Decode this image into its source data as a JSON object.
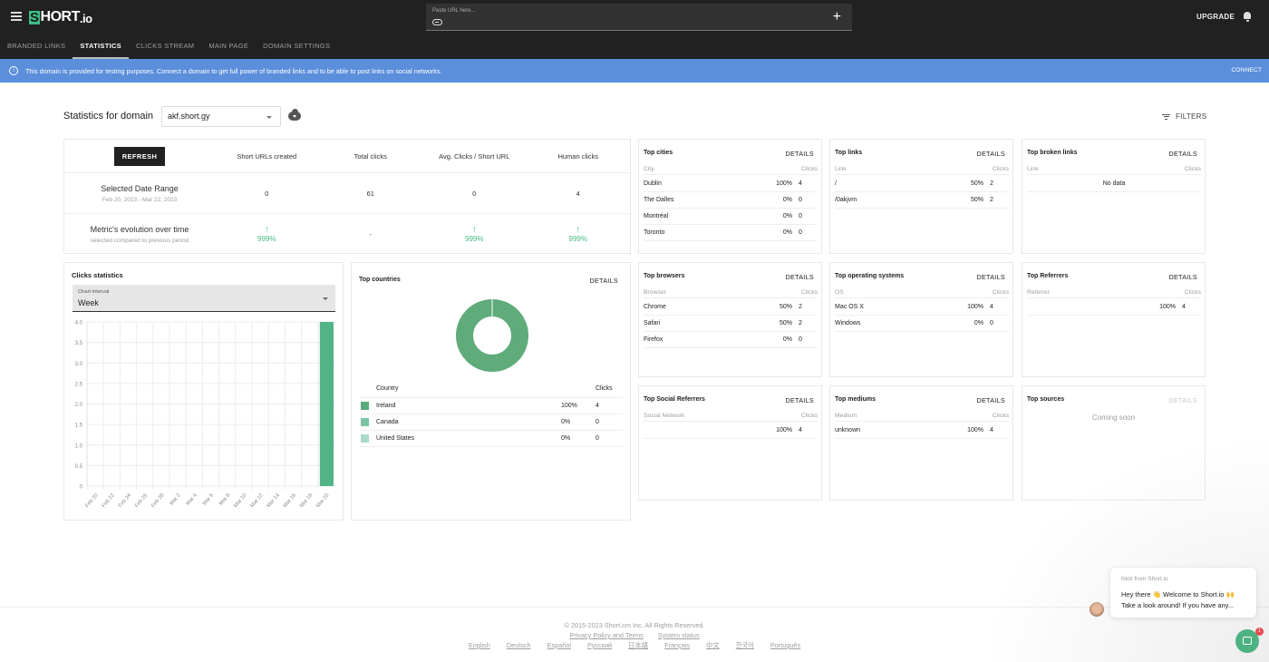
{
  "app": {
    "logo_s": "S",
    "logo_text": "HORT",
    "logo_suffix": ".io",
    "url_placeholder": "Paste URL here...",
    "upgrade_label": "UPGRADE",
    "nav_tabs": [
      {
        "label": "BRANDED LINKS",
        "active": false
      },
      {
        "label": "STATISTICS",
        "active": true
      },
      {
        "label": "CLICKS STREAM",
        "active": false
      },
      {
        "label": "MAIN PAGE",
        "active": false
      },
      {
        "label": "DOMAIN SETTINGS",
        "active": false
      }
    ]
  },
  "banner": {
    "text": "This domain is provided for testing purposes. Connect a domain to get full power of branded links and to be able to post links on social networks.",
    "action": "CONNECT",
    "info_icon": "i"
  },
  "header": {
    "title": "Statistics for domain",
    "domain": "akf.short.gy",
    "filters_label": "FILTERS"
  },
  "summary": {
    "refresh_label": "REFRESH",
    "columns": [
      "Short URLs created",
      "Total clicks",
      "Avg. Clicks / Short URL",
      "Human clicks"
    ],
    "range_label": "Selected Date Range",
    "range_dates": "Feb 20, 2023 - Mar 22, 2023",
    "values": [
      "0",
      "61",
      "0",
      "4"
    ],
    "evolution_label": "Metric's evolution over time",
    "evolution_sub": "selected compared to previous period",
    "evolution": [
      {
        "arrow": "↑",
        "pct": "999%"
      },
      {
        "arrow": "",
        "pct": "-"
      },
      {
        "arrow": "↑",
        "pct": "999%"
      },
      {
        "arrow": "↑",
        "pct": "999%"
      }
    ]
  },
  "clicks_stats": {
    "title": "Clicks statistics",
    "interval_label": "Chart interval",
    "interval_value": "Week"
  },
  "chart_data": {
    "type": "bar",
    "title": "Clicks statistics",
    "xlabel": "",
    "ylabel": "",
    "categories": [
      "Feb 20",
      "Feb 22",
      "Feb 24",
      "Feb 26",
      "Feb 28",
      "Mar 2",
      "Mar 4",
      "Mar 6",
      "Mar 8",
      "Mar 10",
      "Mar 12",
      "Mar 14",
      "Mar 16",
      "Mar 18",
      "Mar 20"
    ],
    "values": [
      0,
      0,
      0,
      0,
      0,
      0,
      0,
      0,
      0,
      0,
      0,
      0,
      0,
      0,
      4
    ],
    "ylim": [
      0,
      4
    ],
    "yticks": [
      "0",
      "0.5",
      "1.0",
      "1.5",
      "2.0",
      "2.5",
      "3.0",
      "3.5",
      "4.0"
    ],
    "grid": true,
    "bar_color": "#52b386"
  },
  "countries": {
    "title": "Top countries",
    "details": "DETAILS",
    "col_country": "Country",
    "col_clicks": "Clicks",
    "rows": [
      {
        "name": "Ireland",
        "pct": "100%",
        "clicks": "4",
        "color": "#5aac7c"
      },
      {
        "name": "Canada",
        "pct": "0%",
        "clicks": "0",
        "color": "#7cc4a4"
      },
      {
        "name": "United States",
        "pct": "0%",
        "clicks": "0",
        "color": "#a9d9cb"
      }
    ],
    "donut": [
      {
        "label": "Ireland",
        "value": 100,
        "color": "#5fab7a"
      }
    ]
  },
  "cards": {
    "cities": {
      "title": "Top cities",
      "details": "DETAILS",
      "col1": "City",
      "col2": "Clicks",
      "rows": [
        {
          "name": "Dublin",
          "pct": "100%",
          "clicks": "4"
        },
        {
          "name": "The Dalles",
          "pct": "0%",
          "clicks": "0"
        },
        {
          "name": "Montréal",
          "pct": "0%",
          "clicks": "0"
        },
        {
          "name": "Toronto",
          "pct": "0%",
          "clicks": "0"
        }
      ]
    },
    "links": {
      "title": "Top links",
      "details": "DETAILS",
      "col1": "Link",
      "col2": "Clicks",
      "rows": [
        {
          "name": "/",
          "pct": "50%",
          "clicks": "2"
        },
        {
          "name": "/0akjvm",
          "pct": "50%",
          "clicks": "2"
        }
      ]
    },
    "broken": {
      "title": "Top broken links",
      "details": "DETAILS",
      "col1": "Link",
      "col2": "Clicks",
      "empty": "No data"
    },
    "browsers": {
      "title": "Top browsers",
      "details": "DETAILS",
      "col1": "Browser",
      "col2": "Clicks",
      "rows": [
        {
          "name": "Chrome",
          "pct": "50%",
          "clicks": "2"
        },
        {
          "name": "Safari",
          "pct": "50%",
          "clicks": "2"
        },
        {
          "name": "Firefox",
          "pct": "0%",
          "clicks": "0"
        }
      ]
    },
    "os": {
      "title": "Top operating systems",
      "details": "DETAILS",
      "col1": "OS",
      "col2": "Clicks",
      "rows": [
        {
          "name": "Mac OS X",
          "pct": "100%",
          "clicks": "4"
        },
        {
          "name": "Windows",
          "pct": "0%",
          "clicks": "0"
        }
      ]
    },
    "referrers": {
      "title": "Top Referrers",
      "details": "DETAILS",
      "col1": "Referrer",
      "col2": "Clicks",
      "rows": [
        {
          "name": "",
          "pct": "100%",
          "clicks": "4"
        }
      ]
    },
    "social": {
      "title": "Top Social Referrers",
      "details": "DETAILS",
      "col1": "Social Network",
      "col2": "Clicks",
      "rows": [
        {
          "name": "",
          "pct": "100%",
          "clicks": "4"
        }
      ]
    },
    "mediums": {
      "title": "Top mediums",
      "details": "DETAILS",
      "col1": "Medium",
      "col2": "Clicks",
      "rows": [
        {
          "name": "unknown",
          "pct": "100%",
          "clicks": "4"
        }
      ]
    },
    "sources": {
      "title": "Top sources",
      "details": "DETAILS",
      "empty": "Coming soon"
    }
  },
  "footer": {
    "copyright": "© 2015-2023  Short.cm Inc. All Rights Reserved.",
    "links": [
      "Privacy Policy and Terms",
      "System status"
    ],
    "languages": [
      "English",
      "Deutsch",
      "Español",
      "Русский",
      "日本語",
      "Français",
      "中文",
      "한국어",
      "Português"
    ]
  },
  "chat": {
    "from": "Nick from Short.io",
    "line1": "Hey there 👋 Welcome to Short.io 🙌",
    "line2": "Take a look around! If you have any...",
    "badge": "1"
  },
  "colors": {
    "topbar": "#212121",
    "banner": "#5b8edb",
    "accent_green": "#4cba86"
  }
}
